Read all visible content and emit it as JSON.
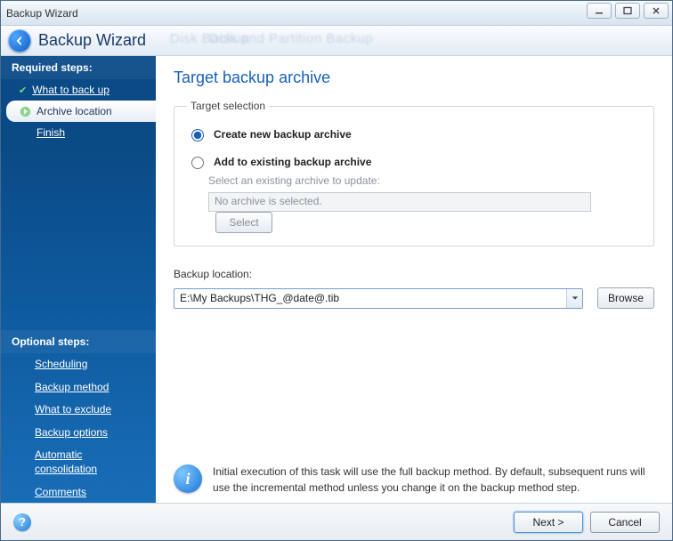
{
  "window": {
    "title": "Backup Wizard"
  },
  "header": {
    "title": "Backup Wizard",
    "ghost1": "Disk Backup",
    "ghost2": "Disk and Partition Backup"
  },
  "sidebar": {
    "required_header": "Required steps:",
    "steps": [
      {
        "label": "What to back up"
      },
      {
        "label": "Archive location"
      },
      {
        "label": "Finish"
      }
    ],
    "optional_header": "Optional steps:",
    "optional": [
      {
        "label": "Scheduling"
      },
      {
        "label": "Backup method"
      },
      {
        "label": "What to exclude"
      },
      {
        "label": "Backup options"
      },
      {
        "label": "Automatic consolidation"
      },
      {
        "label": "Comments"
      }
    ]
  },
  "content": {
    "page_title": "Target backup archive",
    "fieldset_legend": "Target selection",
    "radio_create": "Create new backup archive",
    "radio_add": "Add to existing backup archive",
    "existing_hint": "Select an existing archive to update:",
    "existing_value": "No archive is selected.",
    "select_btn": "Select",
    "location_label": "Backup location:",
    "location_value": "E:\\My Backups\\THG_@date@.tib",
    "browse_btn": "Browse",
    "info_text": "Initial execution of this task will use the full backup method. By default, subsequent runs will use the incremental method unless you change it on the backup method step."
  },
  "footer": {
    "next": "Next >",
    "cancel": "Cancel"
  }
}
